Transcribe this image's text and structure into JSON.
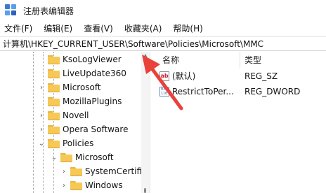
{
  "window": {
    "title": "注册表编辑器"
  },
  "menu": [
    "文件(F)",
    "编辑(E)",
    "查看(V)",
    "收藏夹(A)",
    "帮助(H)"
  ],
  "address": "计算机\\HKEY_CURRENT_USER\\Software\\Policies\\Microsoft\\MMC",
  "tree": [
    {
      "label": "KsoLogViewer",
      "expander": ""
    },
    {
      "label": "LiveUpdate360",
      "expander": ""
    },
    {
      "label": "Microsoft",
      "expander": "›"
    },
    {
      "label": "MozillaPlugins",
      "expander": ""
    },
    {
      "label": "Novell",
      "expander": "›"
    },
    {
      "label": "Opera Software",
      "expander": "›"
    },
    {
      "label": "Policies",
      "expander": "⌄"
    },
    {
      "label": "Microsoft",
      "expander": "⌄"
    },
    {
      "label": "SystemCertifi",
      "expander": "›"
    },
    {
      "label": "Windows",
      "expander": "›"
    }
  ],
  "list": {
    "headers": {
      "name": "名称",
      "type": "类型"
    },
    "rows": [
      {
        "name": "(默认)",
        "type": "REG_SZ",
        "icon": "string-value-icon"
      },
      {
        "name": "RestrictToPer...",
        "type": "REG_DWORD",
        "icon": "binary-value-icon"
      }
    ]
  },
  "colors": {
    "annotation_arrow": "#e8423a",
    "folder": "#f6c855"
  }
}
